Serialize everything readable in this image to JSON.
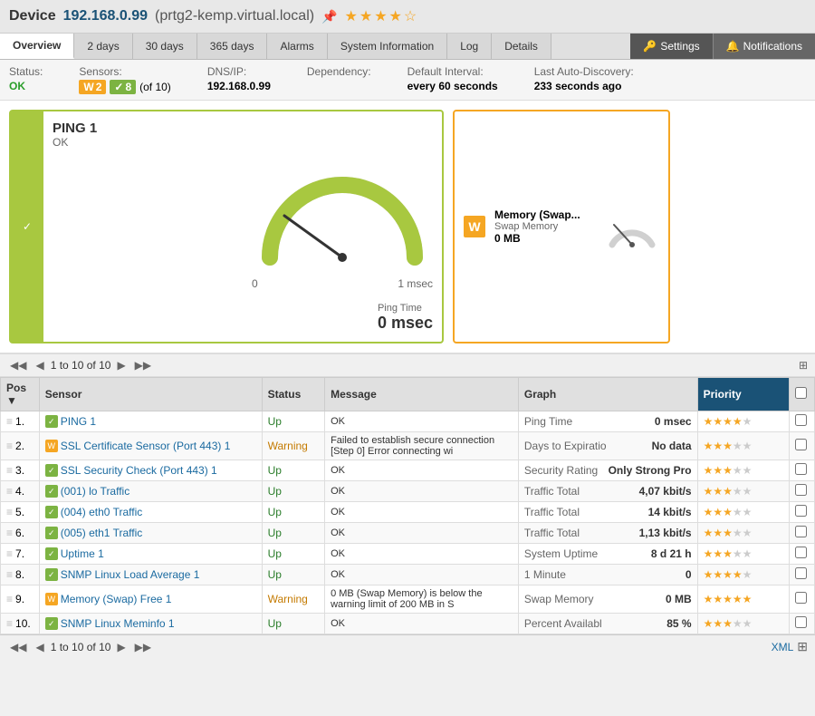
{
  "header": {
    "device_label": "Device",
    "device_ip": "192.168.0.99",
    "device_host": "(prtg2-kemp.virtual.local)",
    "stars": "★★★★☆",
    "pin_icon": "📌"
  },
  "nav": {
    "tabs": [
      {
        "id": "overview",
        "label": "Overview",
        "active": true
      },
      {
        "id": "2days",
        "label": "2 days"
      },
      {
        "id": "30days",
        "label": "30 days"
      },
      {
        "id": "365days",
        "label": "365 days"
      },
      {
        "id": "alarms",
        "label": "Alarms"
      },
      {
        "id": "sysinfo",
        "label": "System Information"
      },
      {
        "id": "log",
        "label": "Log"
      },
      {
        "id": "details",
        "label": "Details"
      }
    ],
    "settings_label": "Settings",
    "notifications_label": "Notifications",
    "settings_icon": "🔑",
    "notifications_icon": "🔔"
  },
  "status_bar": {
    "status_label": "Status:",
    "status_value": "OK",
    "sensors_label": "Sensors:",
    "sensors_warning_count": "2",
    "sensors_ok_count": "8",
    "sensors_total": "(of 10)",
    "dns_label": "DNS/IP:",
    "dns_value": "192.168.0.99",
    "dependency_label": "Dependency:",
    "dependency_value": "",
    "interval_label": "Default Interval:",
    "interval_value": "every 60 seconds",
    "interval_bold": "60",
    "autodiscovery_label": "Last Auto-Discovery:",
    "autodiscovery_value": "233 seconds ago",
    "autodiscovery_bold": "233"
  },
  "ping_widget": {
    "title": "PING 1",
    "status": "OK",
    "value_label": "Ping Time",
    "value": "0 msec",
    "gauge_min": "0",
    "gauge_max": "1 msec",
    "check_icon": "✓"
  },
  "memory_widget": {
    "title": "Memory (Swap...",
    "subtitle": "Swap Memory",
    "value": "0 MB",
    "badge": "W"
  },
  "pagination": {
    "text": "1 to 10 of 10",
    "prev_first": "◀◀",
    "prev": "◀",
    "next": "▶",
    "next_last": "▶▶"
  },
  "table": {
    "columns": [
      "Pos",
      "Sensor",
      "Status",
      "Message",
      "Graph",
      "Priority",
      ""
    ],
    "rows": [
      {
        "pos": "1.",
        "sensor_name": "PING 1",
        "sensor_ok": true,
        "status": "Up",
        "message": "OK",
        "graph_label": "Ping Time",
        "graph_value": "0 msec",
        "stars": 4,
        "total_stars": 5
      },
      {
        "pos": "2.",
        "sensor_name": "SSL Certificate Sensor (Port 443) 1",
        "sensor_ok": false,
        "status": "Warning",
        "message": "Failed to establish secure connection [Step 0] Error connecting wi",
        "graph_label": "Days to Expiratio",
        "graph_value": "No data",
        "stars": 3,
        "total_stars": 5
      },
      {
        "pos": "3.",
        "sensor_name": "SSL Security Check (Port 443) 1",
        "sensor_ok": true,
        "status": "Up",
        "message": "OK",
        "graph_label": "Security Rating",
        "graph_value": "Only Strong Pro",
        "stars": 3,
        "total_stars": 5
      },
      {
        "pos": "4.",
        "sensor_name": "(001) lo Traffic",
        "sensor_ok": true,
        "status": "Up",
        "message": "OK",
        "graph_label": "Traffic Total",
        "graph_value": "4,07 kbit/s",
        "stars": 3,
        "total_stars": 5
      },
      {
        "pos": "5.",
        "sensor_name": "(004) eth0 Traffic",
        "sensor_ok": true,
        "status": "Up",
        "message": "OK",
        "graph_label": "Traffic Total",
        "graph_value": "14 kbit/s",
        "stars": 3,
        "total_stars": 5
      },
      {
        "pos": "6.",
        "sensor_name": "(005) eth1 Traffic",
        "sensor_ok": true,
        "status": "Up",
        "message": "OK",
        "graph_label": "Traffic Total",
        "graph_value": "1,13 kbit/s",
        "stars": 3,
        "total_stars": 5
      },
      {
        "pos": "7.",
        "sensor_name": "Uptime 1",
        "sensor_ok": true,
        "status": "Up",
        "message": "OK",
        "graph_label": "System Uptime",
        "graph_value": "8 d 21 h",
        "stars": 3,
        "total_stars": 5
      },
      {
        "pos": "8.",
        "sensor_name": "SNMP Linux Load Average 1",
        "sensor_ok": true,
        "status": "Up",
        "message": "OK",
        "graph_label": "1 Minute",
        "graph_value": "0",
        "stars": 4,
        "total_stars": 5
      },
      {
        "pos": "9.",
        "sensor_name": "Memory (Swap) Free 1",
        "sensor_ok": false,
        "status": "Warning",
        "message": "0 MB (Swap Memory) is below the warning limit of 200 MB in S",
        "graph_label": "Swap Memory",
        "graph_value": "0 MB",
        "stars": 5,
        "total_stars": 5
      },
      {
        "pos": "10.",
        "sensor_name": "SNMP Linux Meminfo 1",
        "sensor_ok": true,
        "status": "Up",
        "message": "OK",
        "graph_label": "Percent Availabl",
        "graph_value": "85 %",
        "stars": 3,
        "total_stars": 5
      }
    ]
  },
  "bottom": {
    "pagination_text": "1 to 10 of 10",
    "xml_label": "XML",
    "expand_icon": "⊞"
  }
}
